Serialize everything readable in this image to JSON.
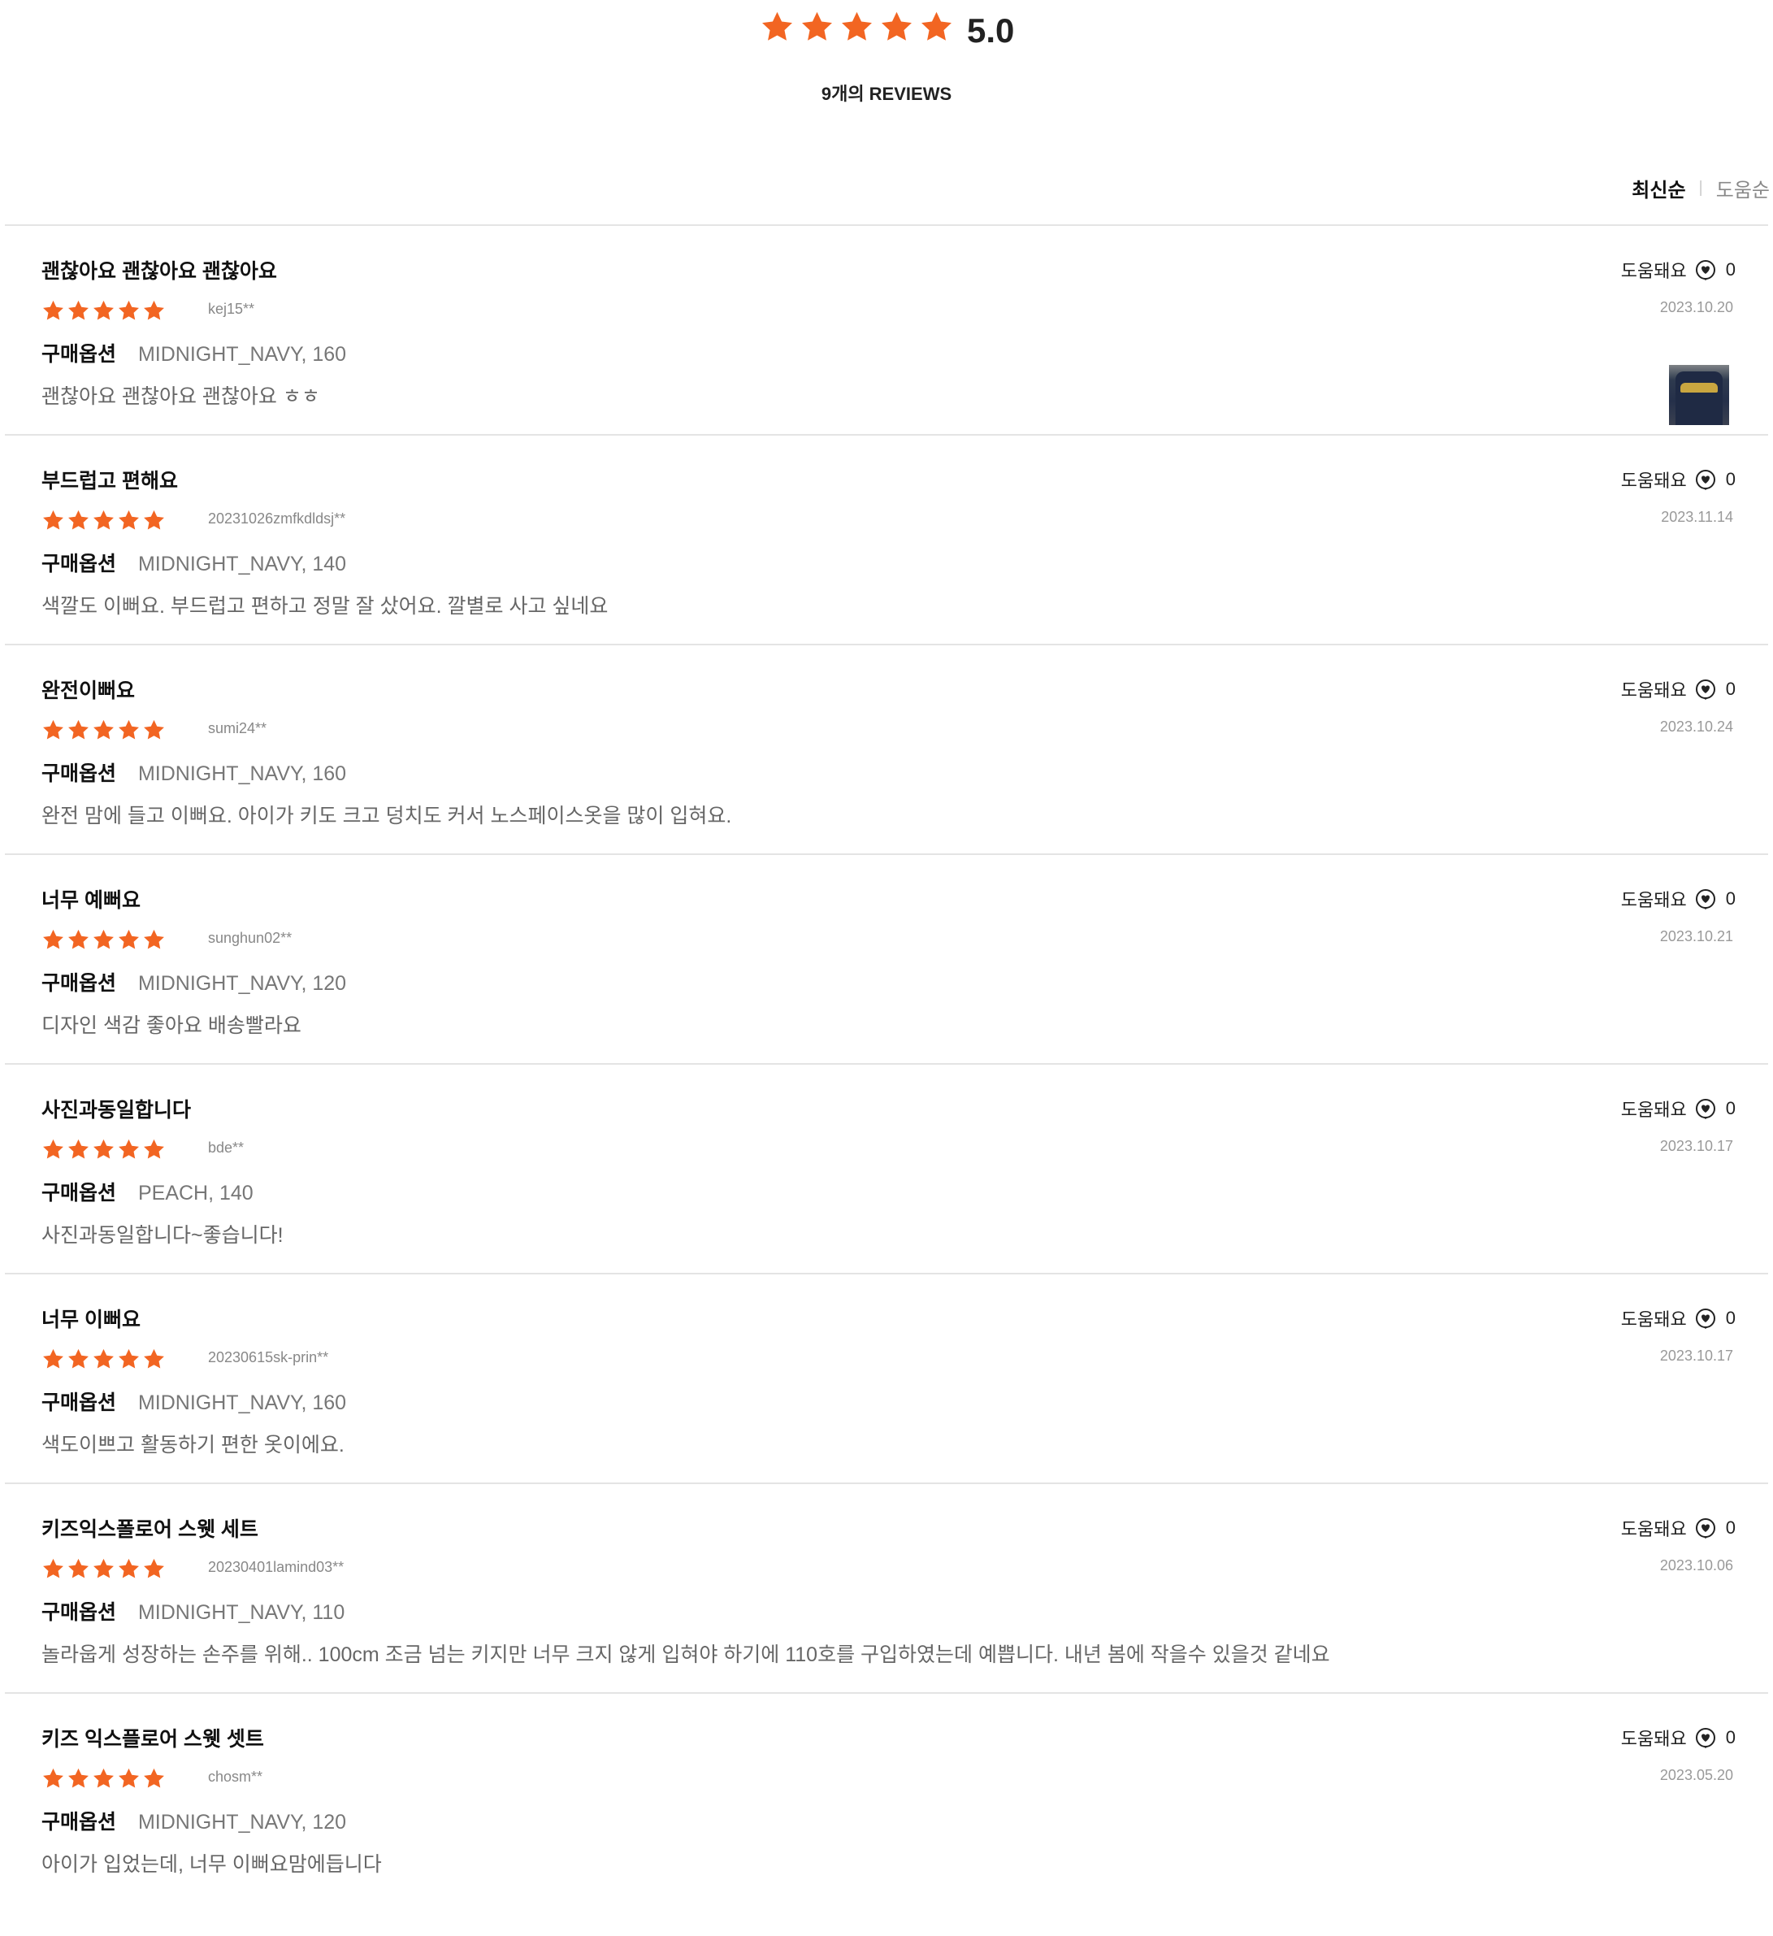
{
  "colors": {
    "accent": "#f26522",
    "border": "#e4e4e4"
  },
  "summary": {
    "stars": 5,
    "score": "5.0",
    "count_label": "9개의 REVIEWS"
  },
  "sort": {
    "options": [
      "최신순",
      "도움순"
    ],
    "active": "최신순"
  },
  "helpful_label": "도움돼요",
  "helpful_icon": "heart-icon",
  "option_label": "구매옵션",
  "reviews": [
    {
      "title": "괜찮아요 괜찮아요 괜찮아요",
      "rating": 5,
      "user": "kej15**",
      "option": "MIDNIGHT_NAVY, 160",
      "body": "괜찮아요 괜찮아요 괜찮아요 ㅎㅎ",
      "helpful": "0",
      "date": "2023.10.20",
      "has_photo": true
    },
    {
      "title": "부드럽고 편해요",
      "rating": 5,
      "user": "20231026zmfkdldsj**",
      "option": "MIDNIGHT_NAVY, 140",
      "body": "색깔도 이뻐요. 부드럽고 편하고 정말 잘 샀어요. 깔별로 사고 싶네요",
      "helpful": "0",
      "date": "2023.11.14",
      "has_photo": false
    },
    {
      "title": "완전이뻐요",
      "rating": 5,
      "user": "sumi24**",
      "option": "MIDNIGHT_NAVY, 160",
      "body": "완전 맘에 들고 이뻐요. 아이가 키도 크고 덩치도 커서 노스페이스옷을 많이 입혀요.",
      "helpful": "0",
      "date": "2023.10.24",
      "has_photo": false
    },
    {
      "title": "너무 예뻐요",
      "rating": 5,
      "user": "sunghun02**",
      "option": "MIDNIGHT_NAVY, 120",
      "body": "디자인 색감 좋아요   배송빨라요",
      "helpful": "0",
      "date": "2023.10.21",
      "has_photo": false
    },
    {
      "title": "사진과동일합니다",
      "rating": 5,
      "user": "bde**",
      "option": "PEACH, 140",
      "body": "사진과동일합니다~좋습니다!",
      "helpful": "0",
      "date": "2023.10.17",
      "has_photo": false
    },
    {
      "title": "너무 이뻐요",
      "rating": 5,
      "user": "20230615sk-prin**",
      "option": "MIDNIGHT_NAVY, 160",
      "body": "색도이쁘고 활동하기 편한  옷이에요.",
      "helpful": "0",
      "date": "2023.10.17",
      "has_photo": false
    },
    {
      "title": "키즈익스폴로어 스웻 세트",
      "rating": 5,
      "user": "20230401lamind03**",
      "option": "MIDNIGHT_NAVY, 110",
      "body": "놀라웁게 성장하는 손주를 위해..  100cm  조금 넘는 키지만 너무 크지 않게 입혀야 하기에 110호를  구입하였는데  예쁩니다. 내년 봄에 작을수 있을것 같네요",
      "helpful": "0",
      "date": "2023.10.06",
      "has_photo": false
    },
    {
      "title": "키즈 익스플로어 스웻 셋트",
      "rating": 5,
      "user": "chosm**",
      "option": "MIDNIGHT_NAVY, 120",
      "body": "아이가 입었는데, 너무 이뻐요맘에듭니다",
      "helpful": "0",
      "date": "2023.05.20",
      "has_photo": false
    }
  ]
}
